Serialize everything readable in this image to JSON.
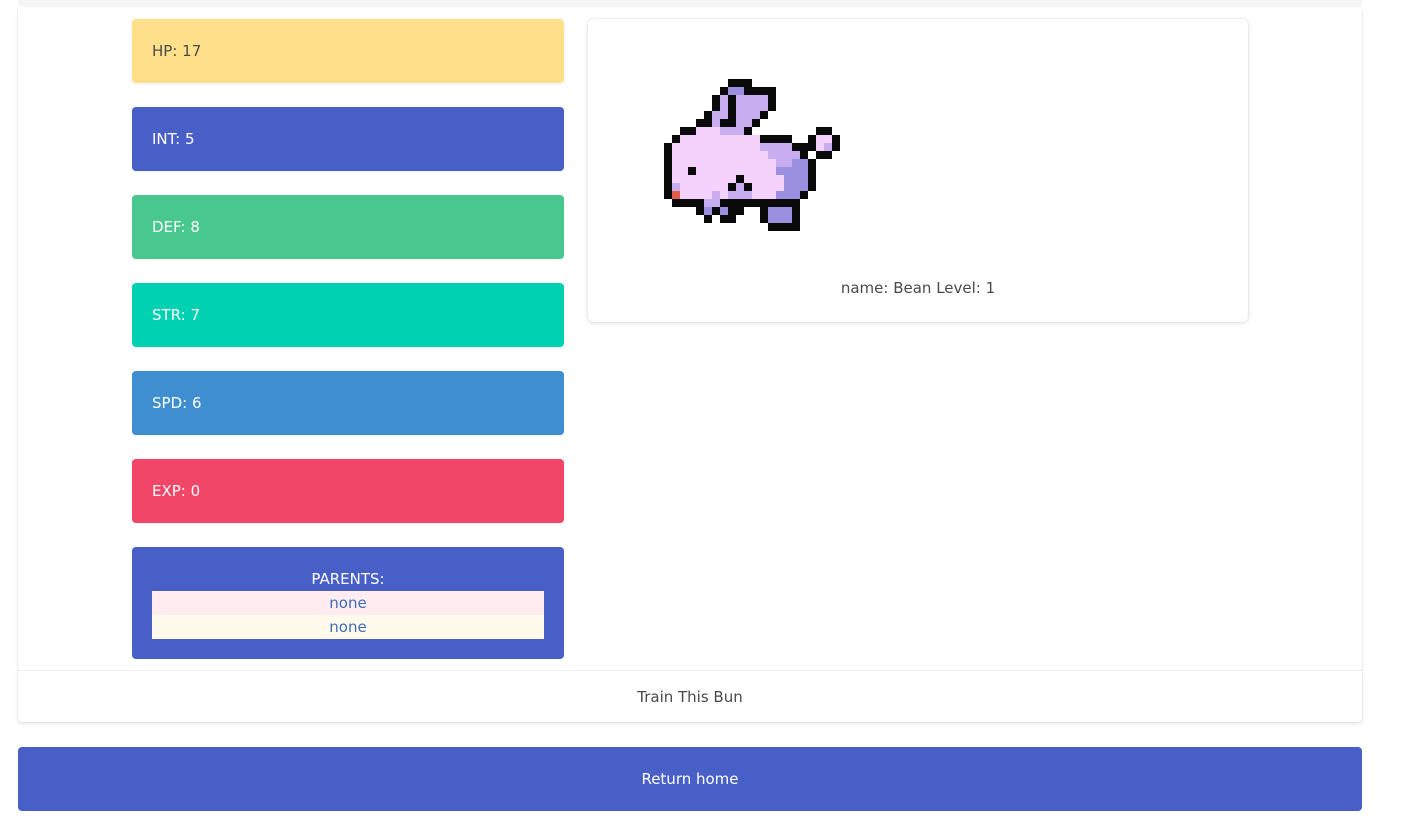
{
  "stats": [
    {
      "label": "HP: 17",
      "color": "#ffe08a",
      "text_color": "#4a4a4a"
    },
    {
      "label": "INT: 5",
      "color": "#485fc7",
      "text_color": "#ffffff"
    },
    {
      "label": "DEF: 8",
      "color": "#48c78e",
      "text_color": "#ffffff"
    },
    {
      "label": "STR: 7",
      "color": "#00d1b2",
      "text_color": "#ffffff"
    },
    {
      "label": "SPD: 6",
      "color": "#3e8ed0",
      "text_color": "#ffffff"
    },
    {
      "label": "EXP: 0",
      "color": "#f14668",
      "text_color": "#ffffff"
    }
  ],
  "parents": {
    "title": "PARENTS:",
    "items": [
      "none",
      "none"
    ]
  },
  "bun": {
    "caption": "name: Bean Level: 1",
    "sprite_icon": "pixel-bunny-icon",
    "palette": {
      "outline": "#0a0a0a",
      "body": "#f5d2fb",
      "shade": "#c8aef0",
      "dark_shade": "#9b8fe0",
      "blush": "#e35d4a"
    }
  },
  "train": {
    "label": "Train This Bun"
  },
  "home": {
    "label": "Return home"
  }
}
